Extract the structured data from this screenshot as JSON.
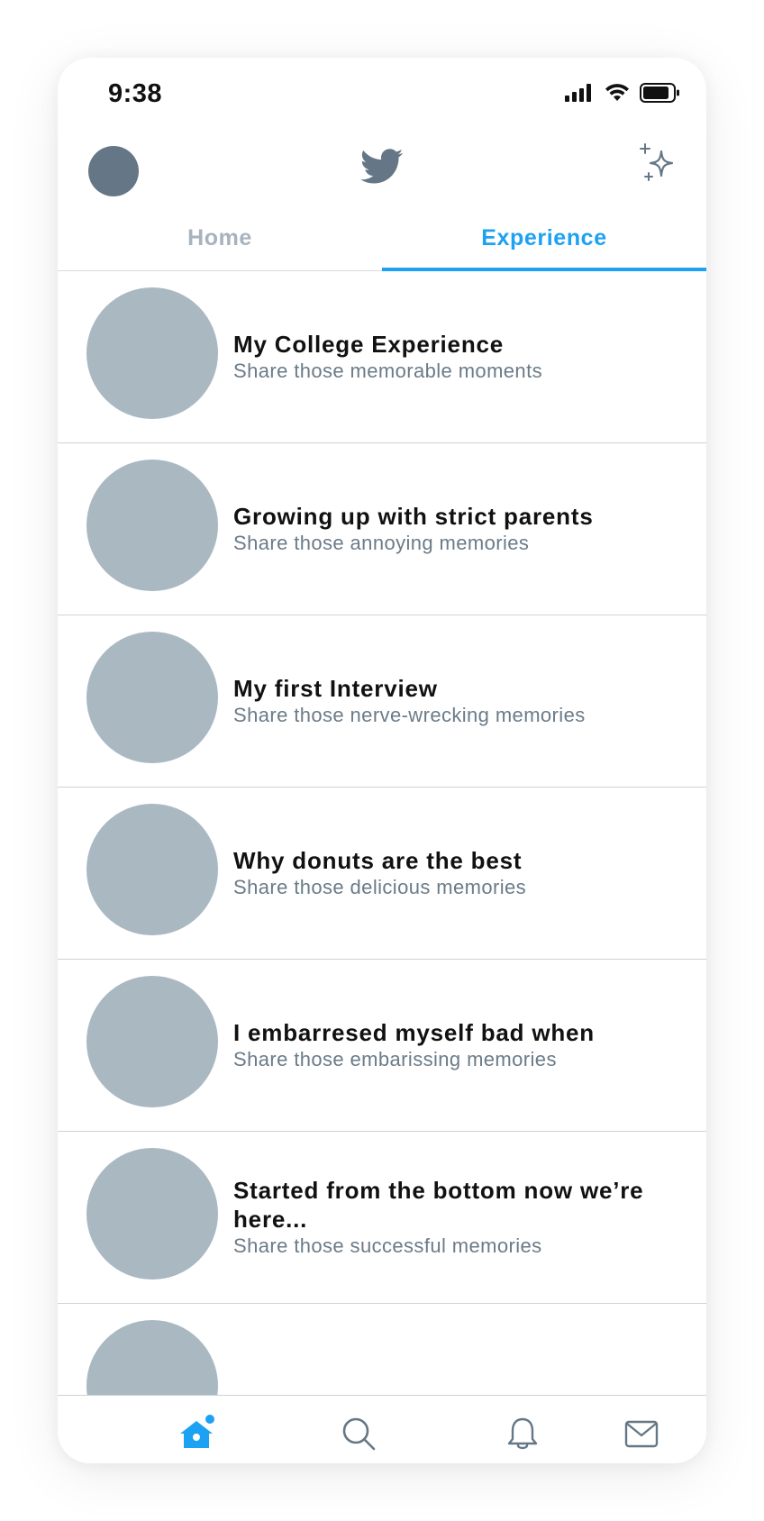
{
  "status_bar": {
    "time": "9:38",
    "icons": [
      "cellular-signal-icon",
      "wifi-icon",
      "battery-icon"
    ]
  },
  "header": {
    "logo": "twitter-bird-icon",
    "action": "sparkle-icon"
  },
  "tabs": [
    {
      "label": "Home",
      "active": false
    },
    {
      "label": "Experience",
      "active": true
    }
  ],
  "list": {
    "items": [
      {
        "title": "My College Experience",
        "subtitle": "Share those memorable moments"
      },
      {
        "title": "Growing up with strict parents",
        "subtitle": "Share those annoying memories"
      },
      {
        "title": "My first Interview",
        "subtitle": "Share those nerve-wrecking memories"
      },
      {
        "title": "Why donuts are the best",
        "subtitle": "Share those delicious memories"
      },
      {
        "title": "I embarresed myself bad when",
        "subtitle": "Share those embarissing memories"
      },
      {
        "title": "Started from the bottom now we’re here...",
        "subtitle": "Share those successful memories"
      }
    ]
  },
  "bottom_nav": {
    "items": [
      {
        "icon": "home-icon",
        "active": true
      },
      {
        "icon": "search-icon",
        "active": false
      },
      {
        "icon": "bell-icon",
        "active": false
      },
      {
        "icon": "mail-icon",
        "active": false
      }
    ]
  },
  "colors": {
    "accent": "#1da1f2",
    "muted_icon": "#657786",
    "placeholder": "#aab8c2",
    "subtitle": "#6b7b88"
  }
}
